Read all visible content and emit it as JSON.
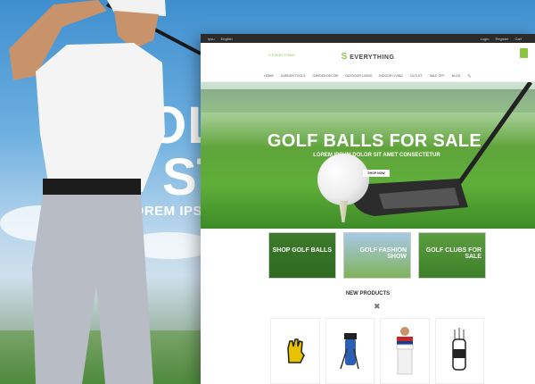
{
  "promo": {
    "title_line1": "GOLF",
    "title_line2": "ST",
    "subtitle": "LOREM IPSU"
  },
  "site": {
    "topbar": {
      "lang": "Ipsu",
      "currency": "English",
      "login": "Login",
      "register": "Register",
      "cart": "Cart"
    },
    "logo_left": "S EVERYTHING",
    "brand": {
      "mark": "S",
      "name": "EVERYTHING"
    },
    "nav": [
      "HOME",
      "GARDEN TOOLS",
      "GARDEN DECOR",
      "OUTDOOR LIVING",
      "INDOOR LIVING",
      "OUTLET",
      "SALE OFF",
      "BLOG"
    ],
    "hero": {
      "title": "GOLF BALLS FOR SALE",
      "subtitle": "LOREM IPSUM DOLOR SIT AMET CONSECTETUR",
      "button": "SHOP NOW"
    },
    "categories": [
      {
        "label": "SHOP GOLF BALLS"
      },
      {
        "label": "GOLF FASHION SHOW"
      },
      {
        "label": "GOLF CLUBS FOR SALE"
      }
    ],
    "new_products_title": "NEW PRODUCTS",
    "products": [
      {
        "icon": "golf-glove-icon"
      },
      {
        "icon": "golf-bag-icon"
      },
      {
        "icon": "golfer-apparel-icon"
      },
      {
        "icon": "golf-cart-bag-icon"
      }
    ]
  },
  "colors": {
    "accent": "#8bc53f",
    "topbar": "#2b2b2b"
  }
}
